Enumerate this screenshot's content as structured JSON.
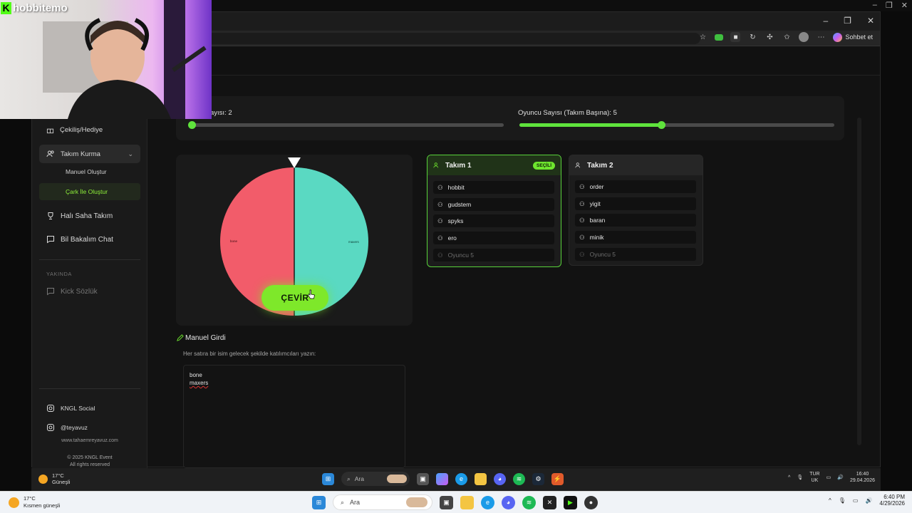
{
  "overlay": {
    "logo_letter": "K",
    "streamer": "hobbitemo"
  },
  "window_controls": {
    "minimize": "–",
    "maximize": "❐",
    "close": "✕"
  },
  "toolbar": {
    "copilot_label": "Sohbet et"
  },
  "sidebar": {
    "cekilis": "Çekiliş/Hediye",
    "takim_kurma": "Takım Kurma",
    "manuel": "Manuel Oluştur",
    "cark": "Çark İle Oluştur",
    "hali_saha": "Halı Saha Takım",
    "bil_bakalim": "Bil Bakalım Chat",
    "yakinda": "YAKINDA",
    "kick_sozluk": "Kick Sözlük",
    "kngl_social": "KNGL Social",
    "teyavuz": "@teyavuz",
    "website": "www.tahaemreyavuz.com",
    "copyright": "© 2025 KNGL Event",
    "rights": "All rights reserved"
  },
  "sliders": {
    "team_count_label": "ayısı: 2",
    "player_count_label": "Oyuncu Sayısı (Takım Başına): 5",
    "team_count_fill": 0,
    "player_count_fill": 0.45
  },
  "wheel": {
    "left_label": "bone",
    "right_label": "maxers",
    "spin_label": "ÇEVİR",
    "colors": {
      "left": "#f25c6a",
      "right": "#5ad9c2"
    }
  },
  "teams": [
    {
      "name": "Takım 1",
      "badge": "SEÇİLİ",
      "players": [
        "hobbit",
        "gudstem",
        "spyks",
        "ero"
      ],
      "placeholder": "Oyuncu 5"
    },
    {
      "name": "Takım 2",
      "players": [
        "order",
        "yigit",
        "baran",
        "minik"
      ],
      "placeholder": "Oyuncu 5"
    }
  ],
  "manual": {
    "title": "Manuel Girdi",
    "help": "Her satıra bir isim gelecek şekilde katılımcıları yazın:",
    "lines": [
      "bone",
      "maxers"
    ]
  },
  "inner_taskbar": {
    "temp": "17°C",
    "weather": "Güneşli",
    "search": "Ara",
    "lang1": "TUR",
    "lang2": "UK",
    "time": "16:40",
    "date": "29.04.2026"
  },
  "outer_taskbar": {
    "temp": "17°C",
    "weather": "Kısmen güneşli",
    "search": "Ara",
    "time": "6:40 PM",
    "date": "4/29/2026"
  },
  "accent": "#5fe33c"
}
